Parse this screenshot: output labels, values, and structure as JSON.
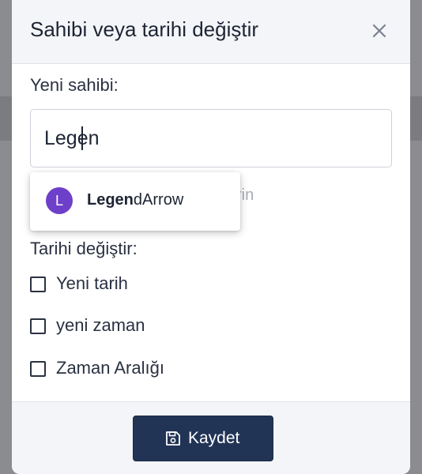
{
  "dialog": {
    "title": "Sahibi veya tarihi değiştir",
    "close_icon": "close-icon"
  },
  "owner": {
    "label": "Yeni sahibi:",
    "input_value": "Legen",
    "hint_visible_fragment": "rin",
    "suggestions": [
      {
        "avatar_letter": "L",
        "avatar_color": "#6e3fc9",
        "match": "Legen",
        "rest": "dArrow"
      }
    ]
  },
  "date": {
    "label": "Tarihi değiştir:",
    "options": [
      {
        "label": "Yeni tarih",
        "checked": false
      },
      {
        "label": "yeni zaman",
        "checked": false
      },
      {
        "label": "Zaman Aralığı",
        "checked": false
      }
    ]
  },
  "footer": {
    "save_label": "Kaydet",
    "save_icon": "save-icon",
    "save_color": "#223456"
  }
}
